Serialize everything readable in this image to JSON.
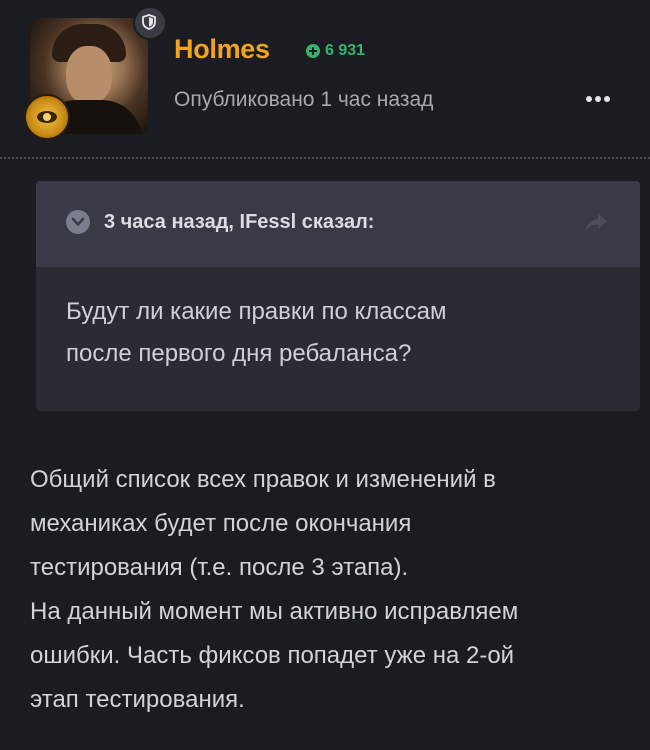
{
  "author": {
    "name": "Holmes",
    "reputation": "6 931",
    "published": "Опубликовано 1 час назад",
    "colors": {
      "name": "#f0a51c",
      "reputation": "#33b56b"
    }
  },
  "quote": {
    "citation": "3 часа назад, IFessl сказал:",
    "lines": [
      "Будут ли какие правки по классам",
      "после первого дня ребаланса?"
    ]
  },
  "content": {
    "lines": [
      "Общий список всех правок и изменений в",
      "механиках будет после окончания",
      "тестирования (т.е. после 3 этапа).",
      "На данный момент мы активно исправляем",
      "ошибки. Часть фиксов попадет уже на 2-ой",
      "этап тестирования."
    ]
  },
  "icons": {
    "moderator": "shield-icon",
    "reputation": "plus-circle-icon",
    "menu": "more-dots-icon",
    "quote_toggle": "chevron-down-icon",
    "share": "share-arrow-icon"
  }
}
